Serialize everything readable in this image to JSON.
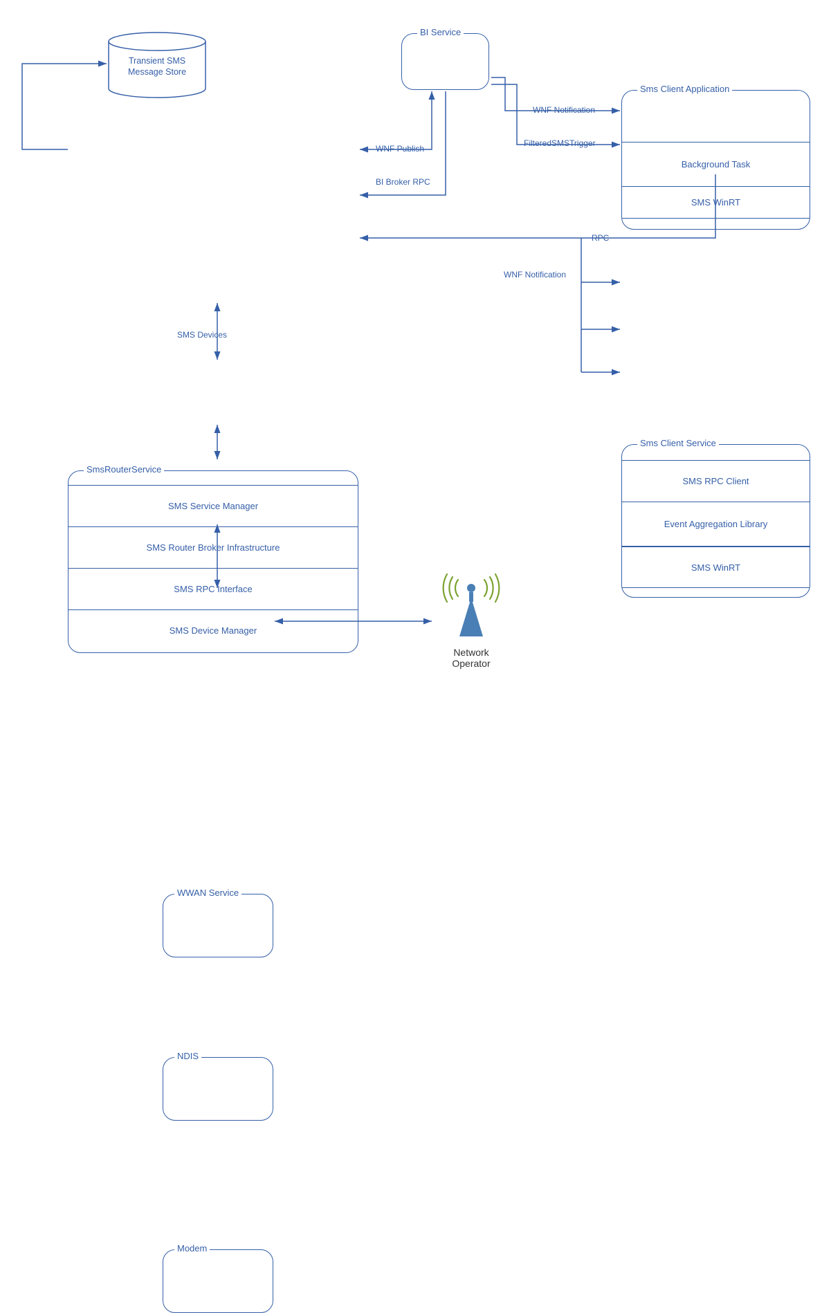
{
  "transientStore": "Transient SMS\nMessage Store",
  "biService": {
    "title": "BI Service"
  },
  "smsClientApp": {
    "title": "Sms Client Application",
    "rows": [
      "Background Task",
      "SMS WinRT"
    ]
  },
  "smsClientService": {
    "title": "Sms Client Service",
    "rows": [
      "SMS RPC Client",
      "Event Aggregation Library",
      "SMS WinRT"
    ]
  },
  "smsRouter": {
    "title": "SmsRouterService",
    "rows": [
      "SMS Service Manager",
      "SMS Router Broker Infrastructure",
      "SMS RPC Interface",
      "SMS Device Manager"
    ]
  },
  "wwan": {
    "title": "WWAN Service"
  },
  "ndis": {
    "title": "NDIS"
  },
  "modem": {
    "title": "Modem"
  },
  "networkOperator": "Network Operator",
  "edges": {
    "smsDevices": "SMS Devices",
    "wnfPublish": "WNF Publish",
    "biBrokerRpc": "BI Broker RPC",
    "wnfNotification1": "WNF Notification",
    "filteredSmsTrigger": "FilteredSMSTrigger",
    "rpc": "RPC",
    "wnfNotification2": "WNF Notification"
  }
}
